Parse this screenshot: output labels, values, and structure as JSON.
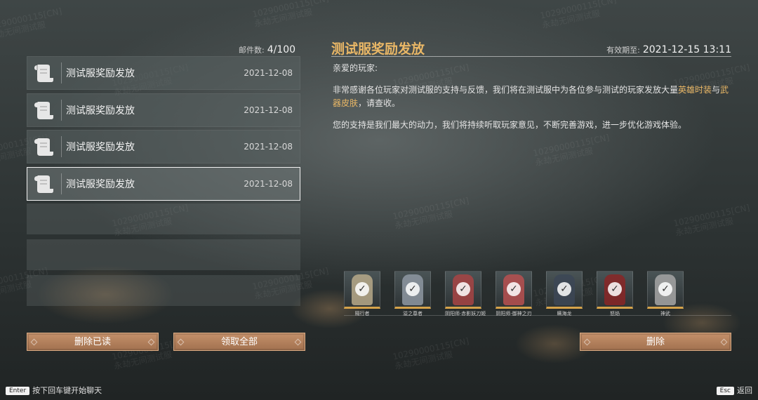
{
  "watermark": {
    "id": "10290000115[CN]",
    "sub": "永劫无间测试服"
  },
  "mailbox": {
    "count_label": "邮件数:",
    "count_value": "4/100",
    "mails": [
      {
        "title": "测试服奖励发放",
        "date": "2021-12-08",
        "selected": false
      },
      {
        "title": "测试服奖励发放",
        "date": "2021-12-08",
        "selected": false
      },
      {
        "title": "测试服奖励发放",
        "date": "2021-12-08",
        "selected": false
      },
      {
        "title": "测试服奖励发放",
        "date": "2021-12-08",
        "selected": true
      }
    ],
    "delete_read_label": "删除已读",
    "claim_all_label": "领取全部"
  },
  "detail": {
    "subject": "测试服奖励发放",
    "expiry_label": "有效期至:",
    "expiry_value": "2021-12-15 13:11",
    "greeting": "亲爱的玩家:",
    "para1_a": "非常感谢各位玩家对测试服的支持与反馈，我们将在测试服中为各位参与测试的玩家发放大量",
    "para1_hl1": "英雄时装",
    "para1_b": "与",
    "para1_hl2": "武器皮肤",
    "para1_c": "，请查收。",
    "para2": "您的支持是我们最大的动力，我们将持续听取玩家意见，不断完善游戏，进一步优化游戏体验。",
    "rewards": [
      {
        "name": "隔行者",
        "color": "#b7a98a"
      },
      {
        "name": "溢之尊者",
        "color": "#8e98a2"
      },
      {
        "name": "阴阳师·赤影妖刀姬",
        "color": "#a84444"
      },
      {
        "name": "阴阳师·御神之刃",
        "color": "#b85050"
      },
      {
        "name": "瞒海龙",
        "color": "#3c4656"
      },
      {
        "name": "怒焰",
        "color": "#8a2626"
      },
      {
        "name": "神武",
        "color": "#a6a6a6"
      }
    ],
    "delete_label": "删除"
  },
  "footer": {
    "enter_key": "Enter",
    "enter_hint": "按下回车键开始聊天",
    "esc_key": "Esc",
    "esc_hint": "返回"
  },
  "colors": {
    "accent": "#e9b766",
    "button": "#b48060"
  }
}
